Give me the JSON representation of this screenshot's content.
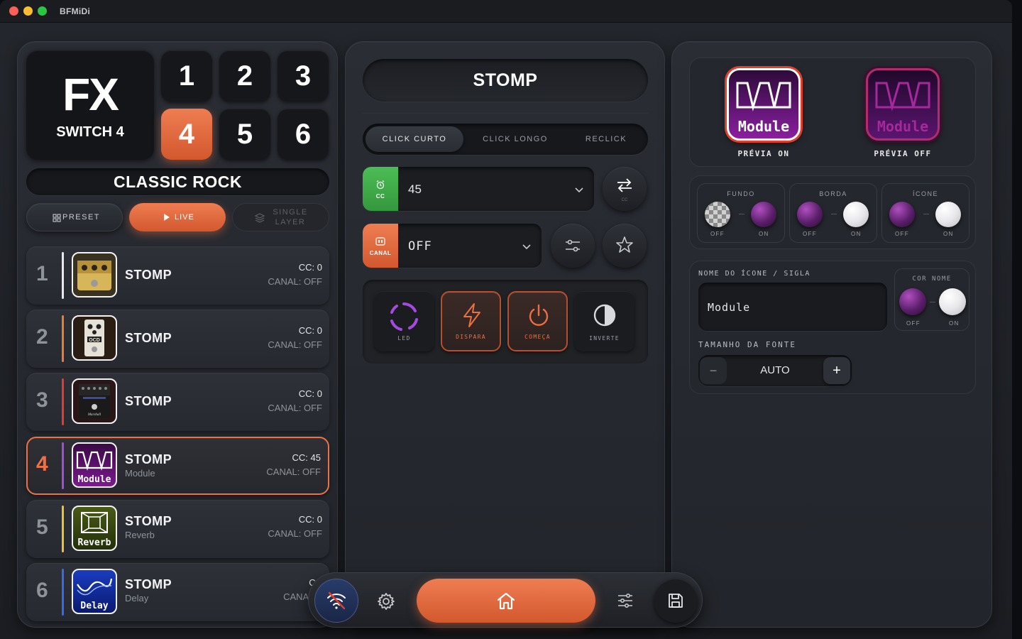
{
  "app": {
    "title": "BFMiDi"
  },
  "left": {
    "fx_title": "FX",
    "fx_subtitle": "SWITCH 4",
    "numbers": [
      "1",
      "2",
      "3",
      "4",
      "5",
      "6"
    ],
    "active_number": "4",
    "preset_name": "CLASSIC ROCK",
    "modes": {
      "preset": "PRESET",
      "live": "LIVE",
      "single_layer": "SINGLE LAYER"
    },
    "rows": [
      {
        "index": "1",
        "name": "STOMP",
        "sub": "",
        "cc": "CC: 0",
        "canal": "CANAL: OFF",
        "bar_color": "#e8e8ec",
        "icon": "yellow-pedal-icon"
      },
      {
        "index": "2",
        "name": "STOMP",
        "sub": "",
        "cc": "CC: 0",
        "canal": "CANAL: OFF",
        "bar_color": "#f07b2f",
        "icon": "ocd-pedal-icon"
      },
      {
        "index": "3",
        "name": "STOMP",
        "sub": "",
        "cc": "CC: 0",
        "canal": "CANAL: OFF",
        "bar_color": "#e8382f",
        "icon": "marshall-pedal-icon"
      },
      {
        "index": "4",
        "name": "STOMP",
        "sub": "Module",
        "cc": "CC: 45",
        "canal": "CANAL: OFF",
        "bar_color": "#a54ae0",
        "icon": "module-icon",
        "thumb_text": "Module"
      },
      {
        "index": "5",
        "name": "STOMP",
        "sub": "Reverb",
        "cc": "CC: 0",
        "canal": "CANAL: OFF",
        "bar_color": "#f0c12f",
        "icon": "reverb-icon",
        "thumb_text": "Reverb"
      },
      {
        "index": "6",
        "name": "STOMP",
        "sub": "Delay",
        "cc": "CC",
        "canal": "CANAL: (",
        "bar_color": "#2f6cf0",
        "icon": "delay-icon",
        "thumb_text": "Delay"
      }
    ]
  },
  "middle": {
    "title": "STOMP",
    "tabs": [
      "CLICK CURTO",
      "CLICK LONGO",
      "RECLICK"
    ],
    "cc_label": "CC",
    "cc_value": "45",
    "swap_sub": "CC",
    "canal_label": "CANAL",
    "canal_value": "OFF",
    "tiles": [
      "LED",
      "DISPARA",
      "COMEÇA",
      "INVERTE"
    ]
  },
  "right": {
    "preview_on_text": "Module",
    "preview_off_text": "Module",
    "preview_on_label": "PRÉVIA ON",
    "preview_off_label": "PRÉVIA OFF",
    "groups": [
      {
        "title": "FUNDO",
        "off": "OFF",
        "on": "ON"
      },
      {
        "title": "BORDA",
        "off": "OFF",
        "on": "ON"
      },
      {
        "title": "ÍCONE",
        "off": "OFF",
        "on": "ON"
      }
    ],
    "icon_name_label": "NOME DO ÍCONE / SIGLA",
    "icon_name_value": "Module",
    "cor_nome_label": "COR NOME",
    "cor_off": "OFF",
    "cor_on": "ON",
    "font_size_label": "TAMANHO DA FONTE",
    "font_size_value": "AUTO",
    "minus": "−",
    "plus": "+"
  },
  "colors": {
    "accent": "#e8703f",
    "green": "#3fae4a",
    "purple": "#a54ae0"
  }
}
